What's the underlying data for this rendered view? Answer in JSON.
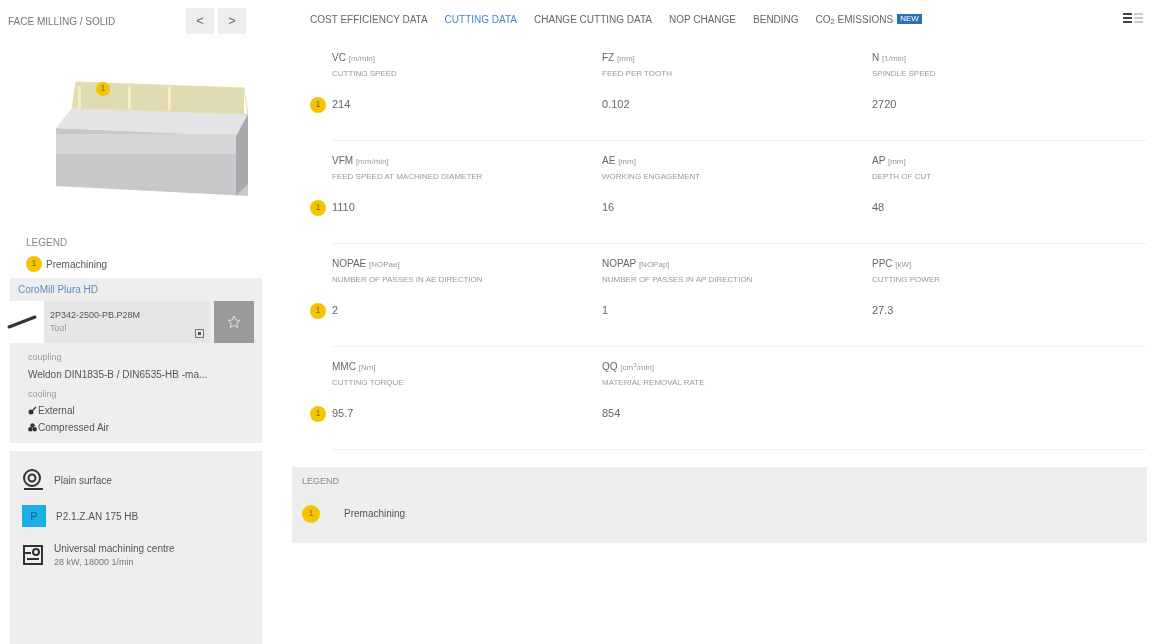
{
  "operation": {
    "title": "FACE MILLING / SOLID",
    "prev": "<",
    "next": ">"
  },
  "model": {
    "kind": "picture",
    "badge": "1"
  },
  "legend_left": {
    "title": "LEGEND",
    "items": [
      {
        "badge": "1",
        "label": "Premachining"
      }
    ]
  },
  "tool": {
    "family": "CoroMill Plura HD",
    "code": "2P342-2500-PB.P28M",
    "type": "Tool",
    "coupling_label": "coupling",
    "coupling": "Weldon DIN1835-B / DIN6535-HB -ma...",
    "cooling_label": "cooling",
    "cooling": [
      {
        "kind": "external",
        "label": "External"
      },
      {
        "kind": "air",
        "label": "Compressed Air"
      }
    ]
  },
  "conditions": [
    {
      "kind": "surface",
      "label": "Plain surface"
    },
    {
      "kind": "material",
      "badge": "P",
      "label": "P2.1.Z.AN 175 HB"
    },
    {
      "kind": "machine",
      "label": "Universal machining centre",
      "detail": "28 kW, 18000 1/min"
    }
  ],
  "tabs": [
    {
      "label": "COST EFFICIENCY DATA",
      "selected": false
    },
    {
      "label": "CUTTING DATA",
      "selected": true
    },
    {
      "label": "CHANGE CUTTING DATA",
      "selected": false
    },
    {
      "label": "NOP CHANGE",
      "selected": false
    },
    {
      "label": "BENDING",
      "selected": false
    },
    {
      "label": "CO$_{2}$ EMISSIONS",
      "selected": false,
      "badge": "NEW"
    }
  ],
  "rows": [
    {
      "badge": "1",
      "cells": [
        {
          "code": "VC",
          "unit": "[m/min]",
          "desc": "CUTTING SPEED",
          "value": "214"
        },
        {
          "code": "FZ",
          "unit": "[mm]",
          "desc": "FEED PER TOOTH",
          "value": "0.102"
        },
        {
          "code": "N",
          "unit": "[1/min]",
          "desc": "SPINDLE SPEED",
          "value": "2720"
        }
      ]
    },
    {
      "badge": "1",
      "cells": [
        {
          "code": "VFM",
          "unit": "[mm/min]",
          "desc": "FEED SPEED AT MACHINED DIAMETER",
          "value": "1110"
        },
        {
          "code": "AE",
          "unit": "[mm]",
          "desc": "WORKING ENGAGEMENT",
          "value": "16"
        },
        {
          "code": "AP",
          "unit": "[mm]",
          "desc": "DEPTH OF CUT",
          "value": "48"
        }
      ]
    },
    {
      "badge": "1",
      "cells": [
        {
          "code": "NOPAE",
          "unit": "[NOPae]",
          "desc": "NUMBER OF PASSES IN AE DIRECTION",
          "value": "2"
        },
        {
          "code": "NOPAP",
          "unit": "[NOPap]",
          "desc": "NUMBER OF PASSES IN AP DIRECTION",
          "value": "1"
        },
        {
          "code": "PPC",
          "unit": "[kW]",
          "desc": "CUTTING POWER",
          "value": "27.3"
        }
      ]
    },
    {
      "badge": "1",
      "cells": [
        {
          "code": "MMC",
          "unit": "[Nm]",
          "desc": "CUTTING TORQUE",
          "value": "95.7"
        },
        {
          "code": "QQ",
          "unit": "[cm$^{3}$/min]",
          "desc": "MATERIAL REMOVAL RATE",
          "value": "854"
        }
      ]
    }
  ],
  "legend": {
    "title": "LEGEND",
    "items": [
      {
        "badge": "1",
        "label": "Premachining"
      }
    ]
  }
}
